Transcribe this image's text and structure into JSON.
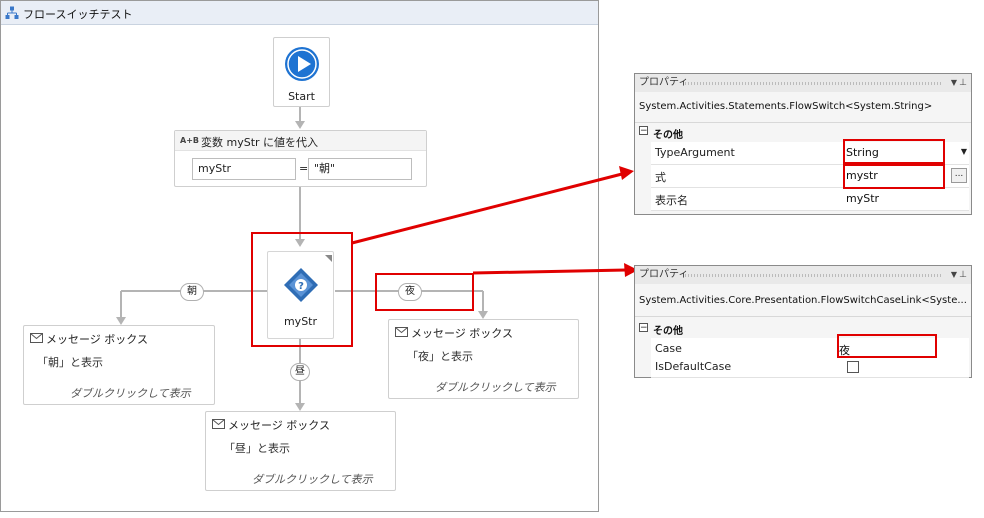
{
  "designer": {
    "title": "フロースイッチテスト",
    "start_label": "Start",
    "assign": {
      "title": "変数 myStr に値を代入",
      "icon_text": "A+B",
      "to_value": "myStr",
      "equals": "=",
      "expr_value": "\"朝\""
    },
    "flow_switch": {
      "label": "myStr"
    },
    "cases": {
      "morning": "朝",
      "noon": "昼",
      "night": "夜"
    },
    "message_boxes": [
      {
        "title": "メッセージ ボックス",
        "body": "「朝」と表示",
        "hint": "ダブルクリックして表示"
      },
      {
        "title": "メッセージ ボックス",
        "body": "「夜」と表示",
        "hint": "ダブルクリックして表示"
      },
      {
        "title": "メッセージ ボックス",
        "body": "「昼」と表示",
        "hint": "ダブルクリックして表示"
      }
    ]
  },
  "properties_switch": {
    "header": "プロパティ",
    "type_name": "System.Activities.Statements.FlowSwitch<System.String>",
    "category": "その他",
    "rows": [
      {
        "name": "TypeArgument",
        "value": "String"
      },
      {
        "name": "式",
        "value": "mystr"
      },
      {
        "name": "表示名",
        "value": "myStr"
      }
    ],
    "ellipsis": "..."
  },
  "properties_case": {
    "header": "プロパティ",
    "type_name": "System.Activities.Core.Presentation.FlowSwitchCaseLink<Syste...",
    "category": "その他",
    "rows": [
      {
        "name": "Case",
        "value": "夜"
      },
      {
        "name": "IsDefaultCase",
        "value": ""
      }
    ]
  },
  "colors": {
    "highlight": "#e00000",
    "start_blue": "#1e73d2",
    "switch_blue": "#2f6db5"
  }
}
